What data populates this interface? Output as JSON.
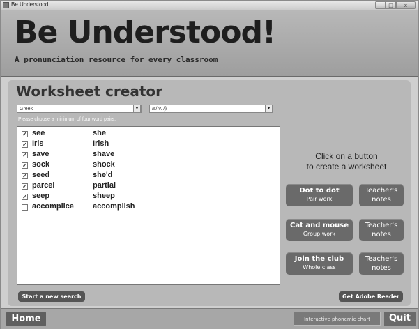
{
  "window": {
    "title": "Be Understood",
    "controls": {
      "minimize": "–",
      "maximize": "□",
      "close": "x"
    }
  },
  "header": {
    "logo": "Be Understood!",
    "tagline": "A pronunciation resource for every classroom"
  },
  "creator": {
    "title": "Worksheet creator",
    "language_select": {
      "value": "Greek"
    },
    "sound_select": {
      "value": "/s/ v. /ʃ/"
    },
    "hint": "Please choose a minimum of four word pairs.",
    "pairs": [
      {
        "checked": true,
        "check_mark": "✓",
        "word1": "see",
        "word2": "she"
      },
      {
        "checked": true,
        "check_mark": "✓",
        "word1": "Iris",
        "word2": "Irish"
      },
      {
        "checked": true,
        "check_mark": "✓",
        "word1": "save",
        "word2": "shave"
      },
      {
        "checked": true,
        "check_mark": "✓",
        "word1": "sock",
        "word2": "shock"
      },
      {
        "checked": true,
        "check_mark": "✓",
        "word1": "seed",
        "word2": "she'd"
      },
      {
        "checked": true,
        "check_mark": "✓",
        "word1": "parcel",
        "word2": "partial"
      },
      {
        "checked": true,
        "check_mark": "✓",
        "word1": "seep",
        "word2": "sheep"
      },
      {
        "checked": false,
        "check_mark": "",
        "word1": "accomplice",
        "word2": "accomplish"
      }
    ],
    "prompt_line1": "Click on a button",
    "prompt_line2": "to create a worksheet",
    "worksheets": [
      {
        "main": "Dot to dot",
        "sub": "Pair work",
        "notes1": "Teacher's",
        "notes2": "notes"
      },
      {
        "main": "Cat and mouse",
        "sub": "Group work",
        "notes1": "Teacher's",
        "notes2": "notes"
      },
      {
        "main": "Join the club",
        "sub": "Whole class",
        "notes1": "Teacher's",
        "notes2": "notes"
      }
    ],
    "new_search": "Start a new search",
    "adobe": "Get Adobe Reader"
  },
  "footer": {
    "home": "Home",
    "phonemic_chart": "Interactive phonemic chart",
    "quit": "Quit"
  }
}
